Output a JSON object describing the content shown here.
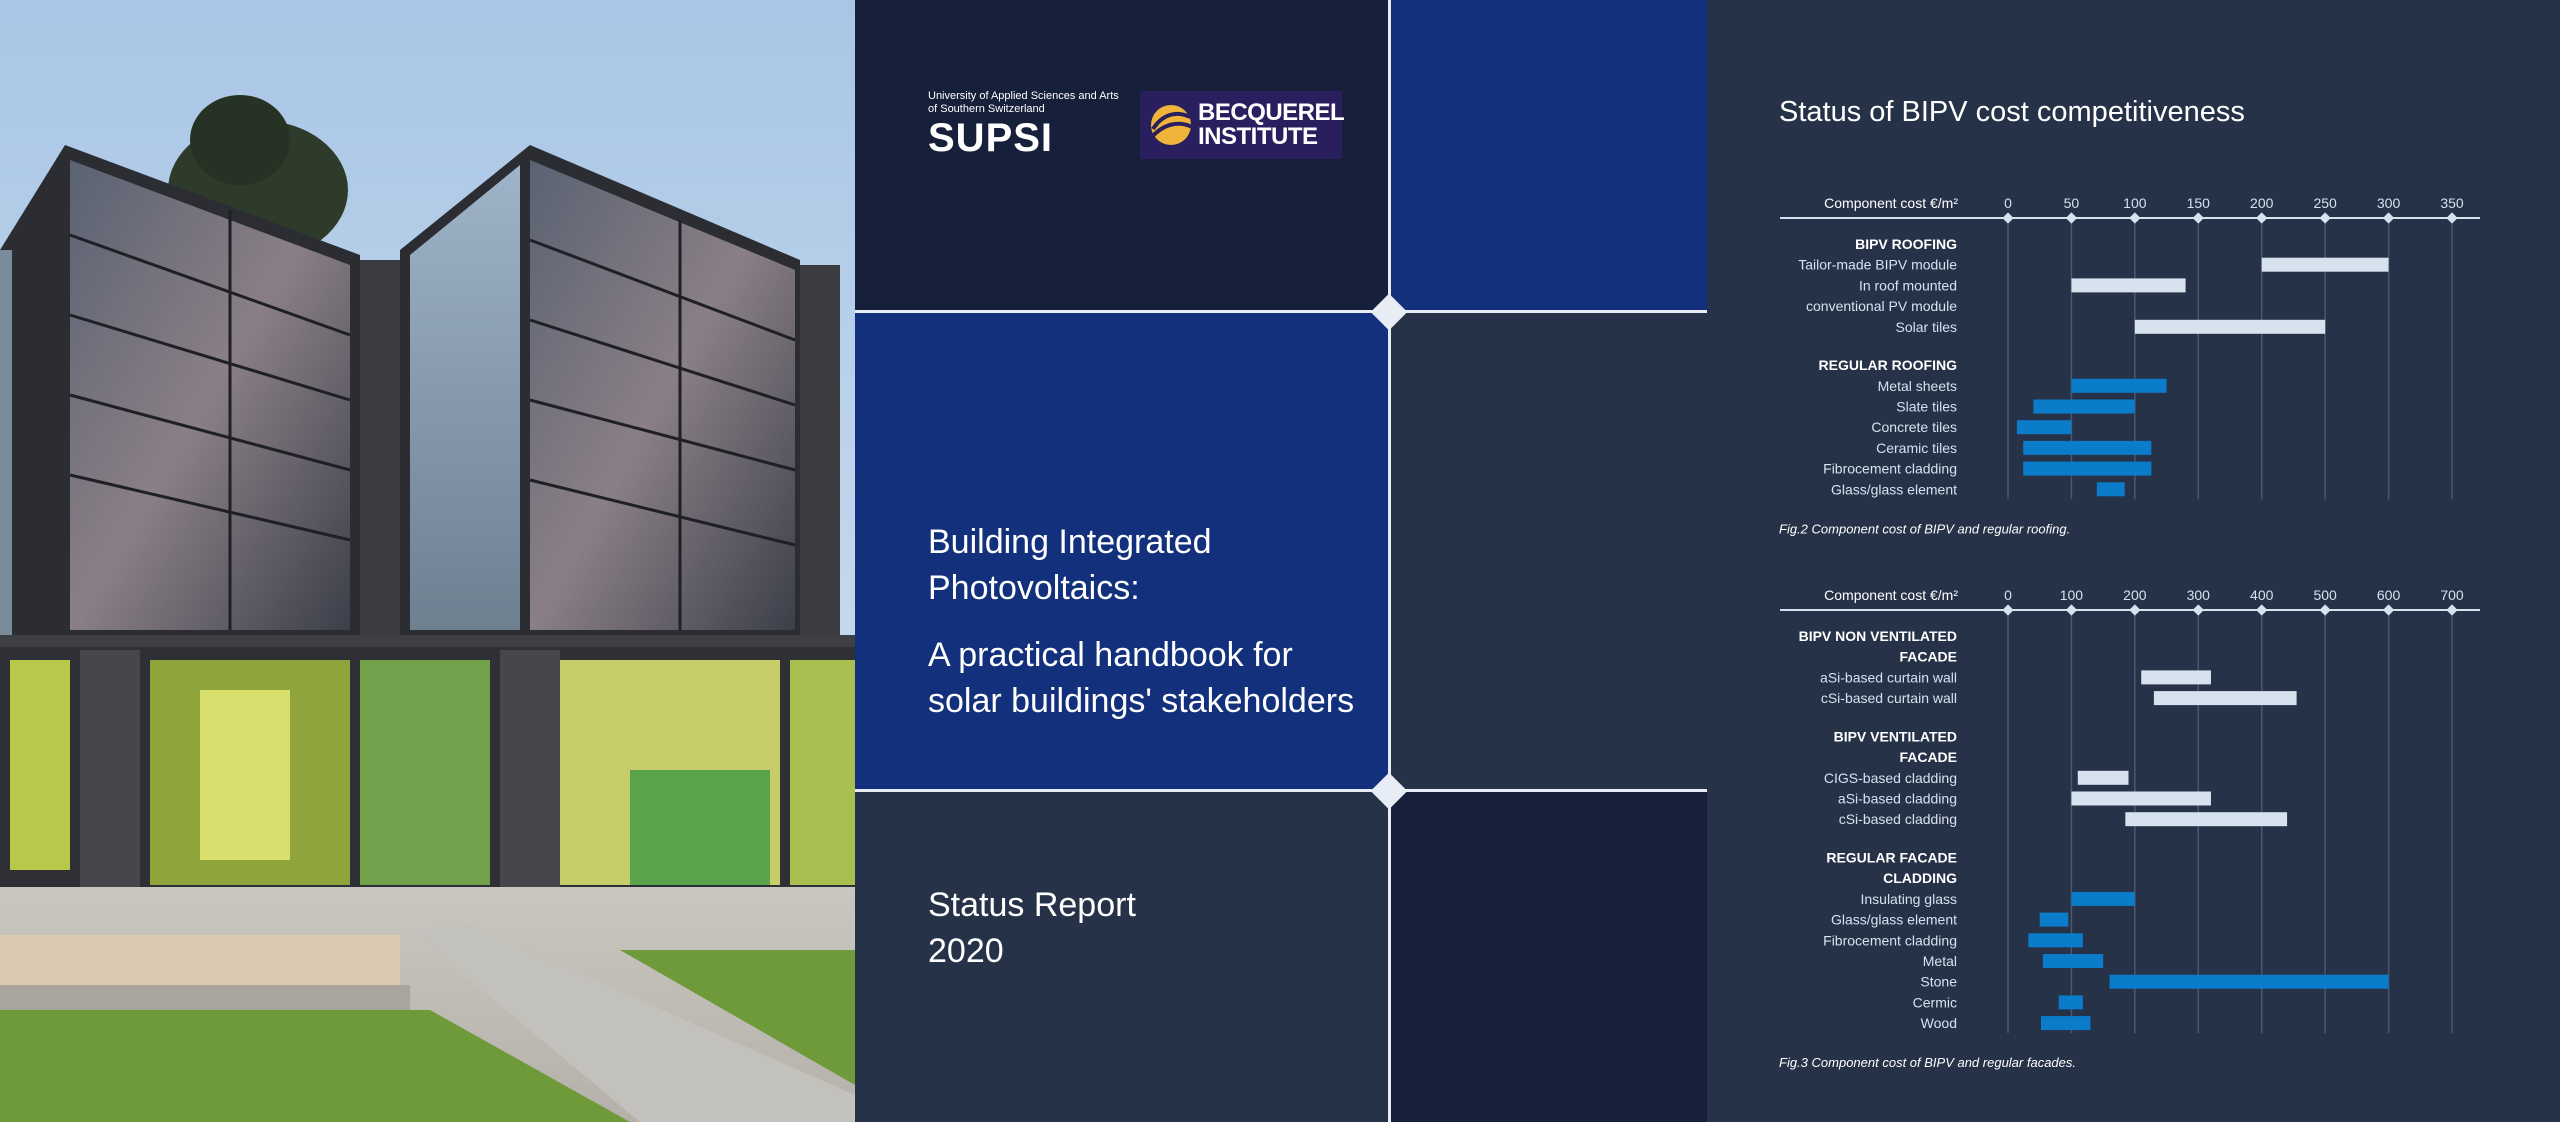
{
  "cover": {
    "supsi_line1": "University of Applied Sciences and Arts",
    "supsi_line2": "of Southern Switzerland",
    "supsi_name": "SUPSI",
    "becquerel_line1": "BECQUEREL",
    "becquerel_line2": "INSTITUTE",
    "title_line1": "Building Integrated",
    "title_line2": "Photovoltaics:",
    "subtitle_line1": "A practical handbook for",
    "subtitle_line2": "solar buildings' stakeholders",
    "report_line1": "Status Report",
    "report_line2": "2020"
  },
  "panel": {
    "title": "Status of BIPV cost competitiveness"
  },
  "colors": {
    "bipv_bar": "#d6e2ee",
    "regular_bar": "#0a7cc9",
    "dark_navy": "#16203a",
    "royal_blue": "#12307c",
    "slate": "#263248"
  },
  "chart_data": [
    {
      "type": "bar",
      "orientation": "horizontal-range",
      "xlabel": "Component cost €/m²",
      "xlim": [
        0,
        350
      ],
      "ticks": [
        0,
        50,
        100,
        150,
        200,
        250,
        300,
        350
      ],
      "grid": true,
      "caption": "Fig.2 Component cost of BIPV and regular roofing.",
      "groups": [
        {
          "name": "BIPV ROOFING",
          "kind": "bipv",
          "items": [
            {
              "label": "Tailor-made BIPV module",
              "range": [
                200,
                300
              ]
            },
            {
              "label": "In roof mounted",
              "range": [
                50,
                140
              ]
            },
            {
              "label": "conventional PV module",
              "range": null
            },
            {
              "label": "Solar tiles",
              "range": [
                100,
                250
              ]
            }
          ]
        },
        {
          "name": "REGULAR ROOFING",
          "kind": "regular",
          "items": [
            {
              "label": "Metal sheets",
              "range": [
                50,
                125
              ]
            },
            {
              "label": "Slate tiles",
              "range": [
                20,
                100
              ]
            },
            {
              "label": "Concrete tiles",
              "range": [
                7,
                50
              ]
            },
            {
              "label": "Ceramic tiles",
              "range": [
                12,
                113
              ]
            },
            {
              "label": "Fibrocement cladding",
              "range": [
                12,
                113
              ]
            },
            {
              "label": "Glass/glass element",
              "range": [
                70,
                92
              ]
            }
          ]
        }
      ]
    },
    {
      "type": "bar",
      "orientation": "horizontal-range",
      "xlabel": "Component cost €/m²",
      "xlim": [
        0,
        700
      ],
      "ticks": [
        0,
        100,
        200,
        300,
        400,
        500,
        600,
        700
      ],
      "grid": true,
      "caption": "Fig.3 Component cost of BIPV and regular facades.",
      "groups": [
        {
          "name_lines": [
            "BIPV NON VENTILATED",
            "FACADE"
          ],
          "kind": "bipv",
          "items": [
            {
              "label": "aSi-based curtain wall",
              "range": [
                210,
                320
              ]
            },
            {
              "label": "cSi-based curtain wall",
              "range": [
                230,
                455
              ]
            }
          ]
        },
        {
          "name_lines": [
            "BIPV VENTILATED",
            "FACADE"
          ],
          "kind": "bipv",
          "items": [
            {
              "label": "CIGS-based cladding",
              "range": [
                110,
                190
              ]
            },
            {
              "label": "aSi-based cladding",
              "range": [
                100,
                320
              ]
            },
            {
              "label": "cSi-based cladding",
              "range": [
                185,
                440
              ]
            }
          ]
        },
        {
          "name_lines": [
            "REGULAR FACADE",
            "CLADDING"
          ],
          "kind": "regular",
          "items": [
            {
              "label": "Insulating glass",
              "range": [
                100,
                200
              ]
            },
            {
              "label": "Glass/glass element",
              "range": [
                50,
                95
              ]
            },
            {
              "label": "Fibrocement cladding",
              "range": [
                32,
                118
              ]
            },
            {
              "label": "Metal",
              "range": [
                55,
                150
              ]
            },
            {
              "label": "Stone",
              "range": [
                160,
                600
              ]
            },
            {
              "label": "Cermic",
              "range": [
                80,
                118
              ]
            },
            {
              "label": "Wood",
              "range": [
                52,
                130
              ]
            }
          ]
        }
      ]
    }
  ]
}
